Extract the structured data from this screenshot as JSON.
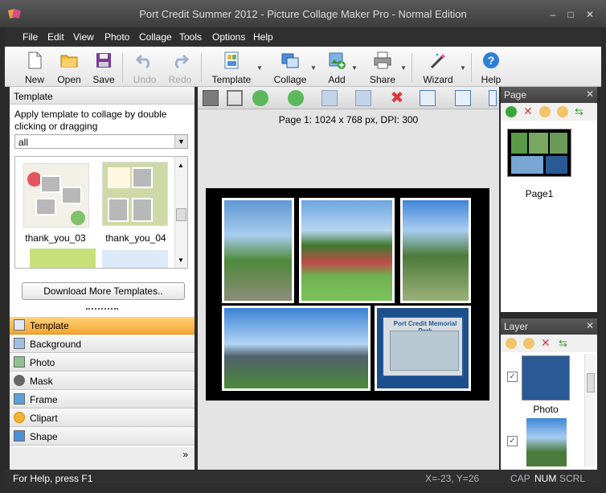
{
  "window": {
    "title": "Port Credit Summer 2012 - Picture Collage Maker Pro - Normal Edition",
    "controls": [
      "–",
      "□",
      "✕"
    ]
  },
  "menu": [
    "File",
    "Edit",
    "View",
    "Photo",
    "Collage",
    "Tools",
    "Options",
    "Help"
  ],
  "toolbar": {
    "new": "New",
    "open": "Open",
    "save": "Save",
    "undo": "Undo",
    "redo": "Redo",
    "template": "Template",
    "collage": "Collage",
    "add": "Add",
    "share": "Share",
    "wizard": "Wizard",
    "help": "Help"
  },
  "template_panel": {
    "title": "Template",
    "description": "Apply template to collage by double clicking or dragging",
    "filter_value": "all",
    "thumbnails": [
      {
        "label": "thank_you_03"
      },
      {
        "label": "thank_you_04"
      }
    ],
    "download_button": "Download More Templates.."
  },
  "nav": {
    "items": [
      {
        "label": "Template",
        "icon": "template-icon"
      },
      {
        "label": "Background",
        "icon": "background-icon"
      },
      {
        "label": "Photo",
        "icon": "photo-icon"
      },
      {
        "label": "Mask",
        "icon": "mask-icon"
      },
      {
        "label": "Frame",
        "icon": "frame-icon"
      },
      {
        "label": "Clipart",
        "icon": "clipart-icon"
      },
      {
        "label": "Shape",
        "icon": "shape-icon"
      }
    ],
    "more": "»"
  },
  "editor": {
    "page_info": "Page 1: 1024 x 768 px, DPI: 300",
    "photo_text": "Port Credit Memorial Park"
  },
  "page_panel": {
    "title": "Page",
    "close": "✕",
    "page_label": "Page1"
  },
  "layer_panel": {
    "title": "Layer",
    "close": "✕",
    "layer_label": "Photo"
  },
  "status": {
    "help": "For Help, press F1",
    "coords": "X=-23, Y=26",
    "cap": "CAP",
    "num": "NUM",
    "scrl": "SCRL"
  },
  "colors": {
    "accent": "#f6a530",
    "chrome": "#2f2f2f"
  }
}
